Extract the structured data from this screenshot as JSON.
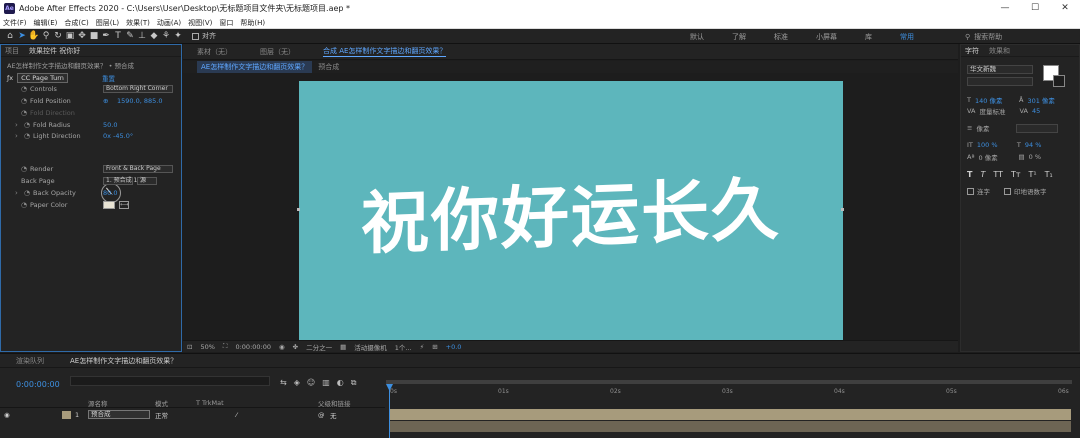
{
  "window": {
    "logo": "Ae",
    "title": "Adobe After Effects 2020 - C:\\Users\\User\\Desktop\\无标题项目文件夹\\无标题项目.aep *",
    "min": "—",
    "max": "☐",
    "close": "✕"
  },
  "menu": [
    "文件(F)",
    "编辑(E)",
    "合成(C)",
    "图层(L)",
    "效果(T)",
    "动画(A)",
    "视图(V)",
    "窗口",
    "帮助(H)"
  ],
  "toolbar": {
    "snap_label": "对齐",
    "workspaces": [
      "默认",
      "了解",
      "标准",
      "小屏幕",
      "库",
      "常用"
    ],
    "active_workspace": "常用",
    "search_help": "搜索帮助"
  },
  "left_panel": {
    "tabs": [
      "项目",
      "效果控件 祝你好"
    ],
    "breadcrumb": "AE怎样制作文字描边和翻页效果？ • 预合成",
    "effect_name": "CC Page Turn",
    "reset": "重置",
    "props": [
      {
        "label": "Controls",
        "dropdown": "Bottom Right Corner"
      },
      {
        "label": "Fold Position",
        "value": "1590.0, 885.0"
      },
      {
        "label": "Fold Direction",
        "value": ""
      },
      {
        "label": "Fold Radius",
        "value": "50.0"
      },
      {
        "label": "Light Direction",
        "value": "0x -45.0°"
      },
      {
        "label": "Render",
        "dropdown": "Front & Back Page"
      },
      {
        "label": "Back Page",
        "dropdown": "1. 预合成 1",
        "extra": "源"
      },
      {
        "label": "Back Opacity",
        "value": "80.0"
      },
      {
        "label": "Paper Color",
        "value": ""
      }
    ]
  },
  "viewer": {
    "tabs": [
      "素材（无）",
      "图层（无）",
      "合成 AE怎样制作文字描边和翻页效果？"
    ],
    "subtabs": [
      "AE怎样制作文字描边和翻页效果？",
      "预合成"
    ],
    "canvas_text": "祝你好运长久",
    "canvas_color": "#5db6bc",
    "bottom": {
      "zoom": "50%",
      "timecode": "0:00:00:00",
      "resolution": "二分之一",
      "camera": "活动摄像机",
      "views": "1个...",
      "exposure": "+0.0"
    }
  },
  "right_panel": {
    "tabs": [
      "字符",
      "效果和"
    ],
    "font": "华文新魏",
    "font_size": "140 像素",
    "leading": "301 像素",
    "kerning": "度量标准",
    "tracking": "45",
    "stroke_px": "像素",
    "vscale": "100 %",
    "hscale": "94 %",
    "baseline": "0 像素",
    "tsume": "0 %",
    "style_buttons": [
      "T",
      "T",
      "TT",
      "Tт",
      "T¹",
      "T₁"
    ],
    "checkbox1": "连字",
    "checkbox2": "印地语数字"
  },
  "timeline": {
    "tabs": [
      "渲染队列",
      "AE怎样制作文字描边和翻页效果？"
    ],
    "timecode": "0:00:00:00",
    "header": [
      "源名称",
      "模式",
      "T TrkMat",
      "父级和链接"
    ],
    "layer": {
      "index": "1",
      "name": "预合成",
      "mode": "正常",
      "parent": "无"
    },
    "ruler_ticks": [
      "0s",
      "01s",
      "02s",
      "03s",
      "04s",
      "05s",
      "06s"
    ]
  }
}
